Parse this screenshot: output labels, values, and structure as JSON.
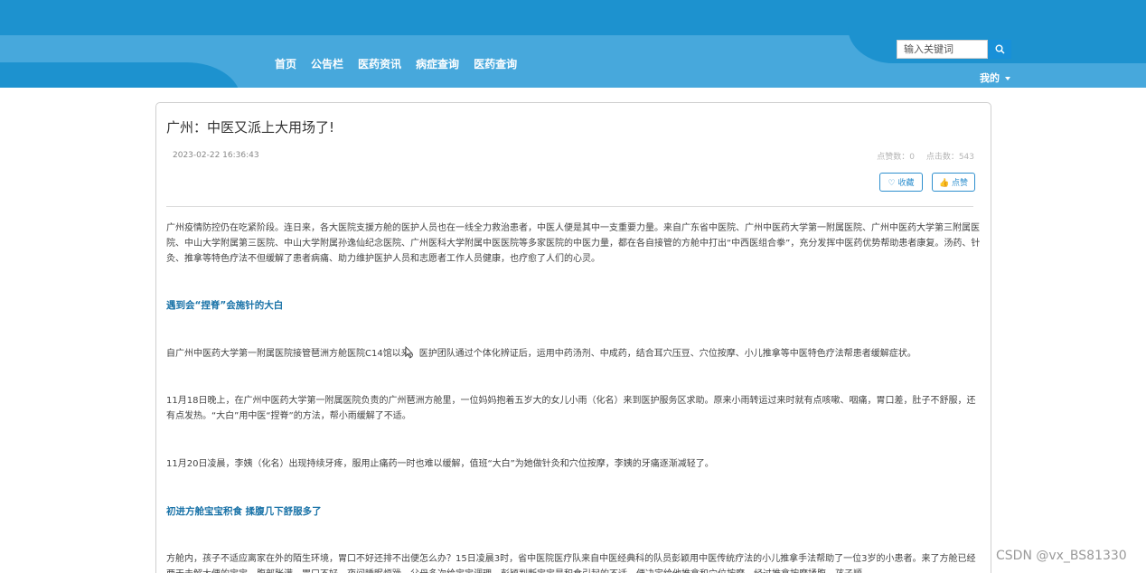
{
  "header": {
    "nav": [
      "首页",
      "公告栏",
      "医药资讯",
      "病症查询",
      "医药查询"
    ],
    "search_placeholder": "输入关键词",
    "user_menu": "我的"
  },
  "article": {
    "title": "广州：中医又派上大用场了!",
    "date": "2023-02-22 16:36:43",
    "likes_label": "点赞数：0",
    "clicks_label": "点击数：543",
    "favorite_label": "♡ 收藏",
    "like_label": "👍 点赞",
    "paragraphs": [
      "广州疫情防控仍在吃紧阶段。连日来，各大医院支援方舱的医护人员也在一线全力救治患者，中医人便是其中一支重要力量。来自广东省中医院、广州中医药大学第一附属医院、广州中医药大学第三附属医院、中山大学附属第三医院、中山大学附属孙逸仙纪念医院、广州医科大学附属中医医院等多家医院的中医力量，都在各自接管的方舱中打出“中西医组合拳”，充分发挥中医药优势帮助患者康复。汤药、针灸、推拿等特色疗法不但缓解了患者病痛、助力维护医护人员和志愿者工作人员健康，也疗愈了人们的心灵。",
      "遇到会“捏脊”会施针的大白",
      "自广州中医药大学第一附属医院接管琶洲方舱医院C14馆以来，医护团队通过个体化辨证后，运用中药汤剂、中成药，结合耳穴压豆、穴位按摩、小儿推拿等中医特色疗法帮患者缓解症状。",
      "11月18日晚上，在广州中医药大学第一附属医院负责的广州琶洲方舱里，一位妈妈抱着五岁大的女儿小雨（化名）来到医护服务区求助。原来小雨转运过来时就有点咳嗽、咽痛，胃口差，肚子不舒服，还有点发热。“大白”用中医“捏脊”的方法，帮小雨缓解了不适。",
      "11月20日凌晨，李姨（化名）出现持续牙疼，服用止痛药一时也难以缓解，值班“大白”为她做针灸和穴位按摩，李姨的牙痛逐渐减轻了。",
      "初进方舱宝宝积食 揉腹几下舒服多了",
      "方舱内，孩子不适应离家在外的陌生环境，胃口不好还排不出便怎么办？15日凌晨3时，省中医院医疗队来自中医经典科的队员彭颖用中医传统疗法的小儿推拿手法帮助了一位3岁的小患者。来了方舱已经两天未解大便的宝宝，腹部胀满，胃口不好，夜间睡眠烦躁，父母多次给宝宝调理，彭颖判断宝宝是积食引起的不适，便决定给他推拿和穴位按摩，经过推拿按摩揉腹，孩子顺"
    ]
  },
  "watermark": "CSDN @vx_BS81330"
}
